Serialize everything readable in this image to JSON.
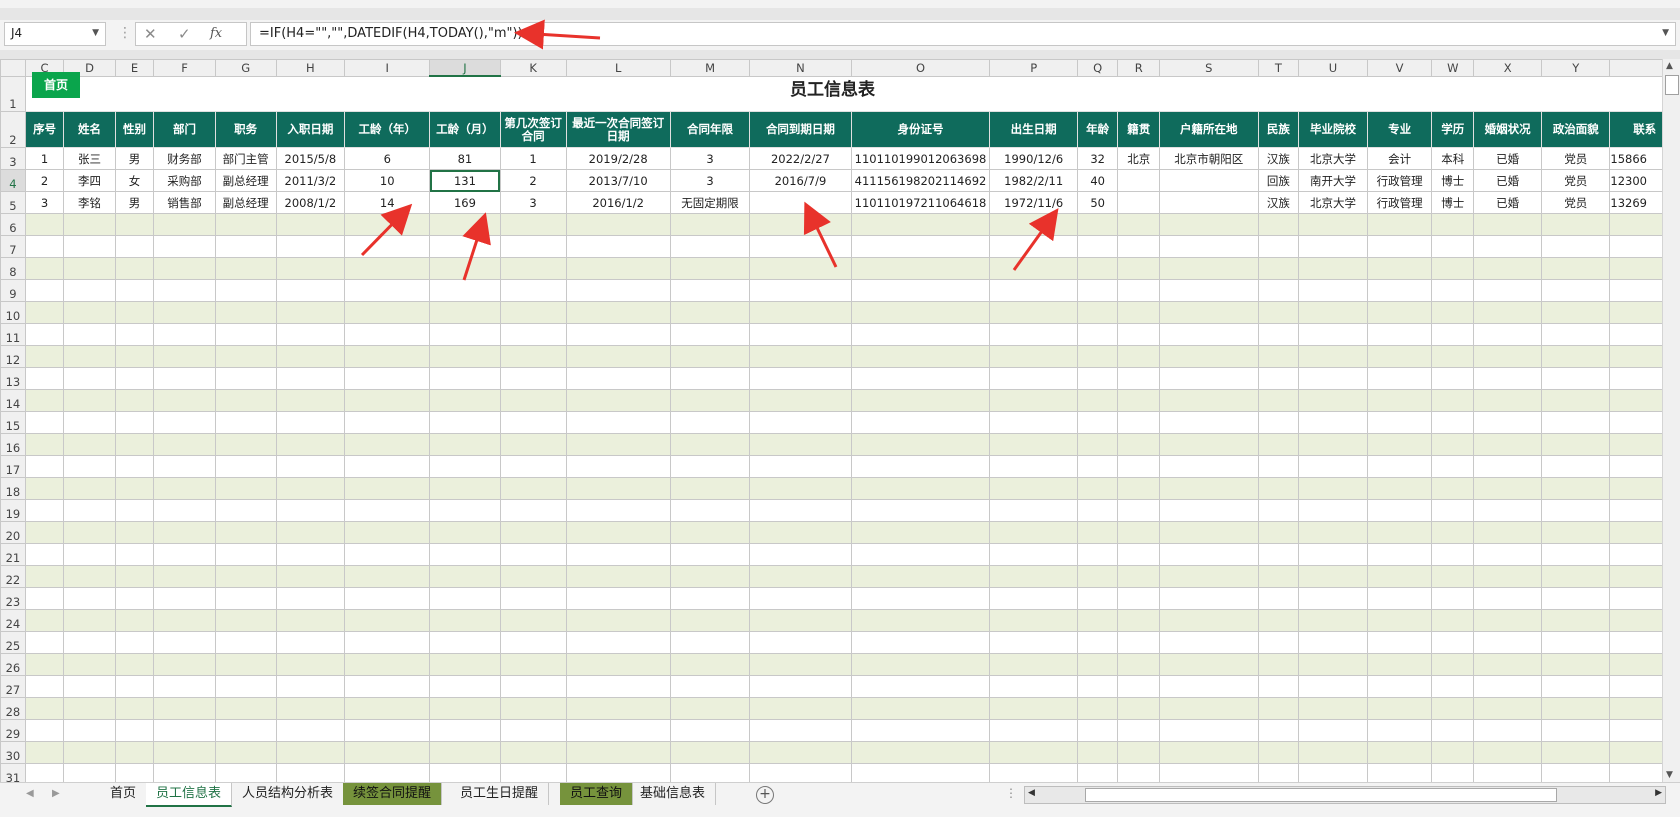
{
  "formula_bar": {
    "name_box": "J4",
    "fx_label": "fx",
    "cancel_glyph": "✕",
    "enter_glyph": "✓",
    "formula": "=IF(H4=\"\",\"\",DATEDIF(H4,TODAY(),\"m\"))"
  },
  "columns": [
    "C",
    "D",
    "E",
    "F",
    "G",
    "H",
    "I",
    "J",
    "K",
    "L",
    "M",
    "N",
    "O",
    "P",
    "Q",
    "R",
    "S",
    "T",
    "U",
    "V",
    "W",
    "X",
    "Y",
    ""
  ],
  "row_numbers": [
    "1",
    "2",
    "3",
    "4",
    "5",
    "6",
    "7",
    "8",
    "9",
    "10",
    "11",
    "12",
    "13",
    "14",
    "15",
    "16",
    "17",
    "18",
    "19",
    "20",
    "21",
    "22",
    "23",
    "24",
    "25",
    "26",
    "27",
    "28",
    "29",
    "30",
    "31"
  ],
  "sheet": {
    "home_button": "首页",
    "title": "员工信息表",
    "headers": [
      "序号",
      "姓名",
      "性别",
      "部门",
      "职务",
      "入职日期",
      "工龄（年）",
      "工龄（月）",
      "第几次签订合同",
      "最近一次合同签订日期",
      "合同年限",
      "合同到期日期",
      "身份证号",
      "出生日期",
      "年龄",
      "籍贯",
      "户籍所在地",
      "民族",
      "毕业院校",
      "专业",
      "学历",
      "婚姻状况",
      "政治面貌",
      "联系"
    ],
    "rows": [
      [
        "1",
        "张三",
        "男",
        "财务部",
        "部门主管",
        "2015/5/8",
        "6",
        "81",
        "1",
        "2019/2/28",
        "3",
        "2022/2/27",
        "110110199012063698",
        "1990/12/6",
        "32",
        "北京",
        "北京市朝阳区",
        "汉族",
        "北京大学",
        "会计",
        "本科",
        "已婚",
        "党员",
        "15866"
      ],
      [
        "2",
        "李四",
        "女",
        "采购部",
        "副总经理",
        "2011/3/2",
        "10",
        "131",
        "2",
        "2013/7/10",
        "3",
        "2016/7/9",
        "411156198202114692",
        "1982/2/11",
        "40",
        "",
        "",
        "回族",
        "南开大学",
        "行政管理",
        "博士",
        "已婚",
        "党员",
        "12300"
      ],
      [
        "3",
        "李铭",
        "男",
        "销售部",
        "副总经理",
        "2008/1/2",
        "14",
        "169",
        "3",
        "2016/1/2",
        "无固定期限",
        "",
        "110110197211064618",
        "1972/11/6",
        "50",
        "",
        "",
        "汉族",
        "北京大学",
        "行政管理",
        "博士",
        "已婚",
        "党员",
        "13269"
      ]
    ]
  },
  "tabs": [
    {
      "label": "首页",
      "style": "normal"
    },
    {
      "label": "员工信息表",
      "style": "active"
    },
    {
      "label": "人员结构分析表",
      "style": "normal"
    },
    {
      "label": "续签合同提醒",
      "style": "green"
    },
    {
      "label": "员工生日提醒",
      "style": "normal"
    },
    {
      "label": "员工查询",
      "style": "green"
    },
    {
      "label": "基础信息表",
      "style": "normal"
    }
  ],
  "colors": {
    "header_fill": "#0f6b5c",
    "band_fill": "#ebf0dc",
    "home_button": "#0aa54c",
    "annotation_arrow": "#e8322b",
    "selection": "#217346"
  }
}
